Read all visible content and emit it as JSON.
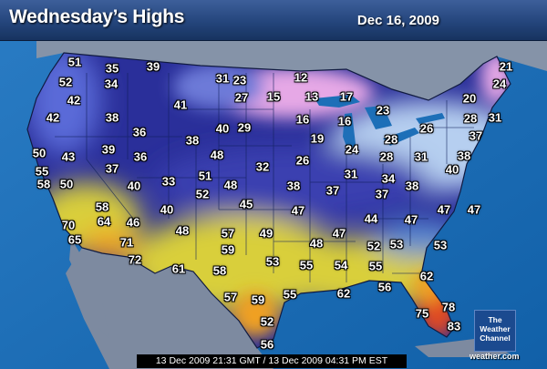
{
  "header": {
    "title": "Wednesday’s Highs",
    "date": "Dec 16, 2009"
  },
  "footer": {
    "timestamp": "13 Dec 2009 21:31 GMT / 13 Dec 2009 04:31 PM EST"
  },
  "logo": {
    "line1": "The",
    "line2": "Weather",
    "line3": "Channel",
    "site": "weather.com"
  },
  "colors": {
    "ocean": "#1d6fb8",
    "neighbor_land": "#7d8aa0",
    "very_cold": "#e6a8e6",
    "cold": "#b6cff0",
    "cool": "#4b56c8",
    "mild": "#2a2f9a",
    "warm": "#d9cf3a",
    "hot": "#f0a020",
    "very_hot": "#e04a20"
  },
  "temperatures": [
    "51",
    "35",
    "39",
    "31",
    "23",
    "12",
    "21",
    "52",
    "34",
    "27",
    "15",
    "13",
    "17",
    "20",
    "24",
    "42",
    "41",
    "23",
    "42",
    "38",
    "36",
    "40",
    "29",
    "16",
    "16",
    "26",
    "28",
    "31",
    "37",
    "38",
    "19",
    "28",
    "50",
    "43",
    "39",
    "36",
    "48",
    "32",
    "26",
    "24",
    "28",
    "31",
    "38",
    "55",
    "37",
    "51",
    "31",
    "34",
    "40",
    "58",
    "50",
    "40",
    "33",
    "52",
    "48",
    "38",
    "37",
    "37",
    "38",
    "45",
    "47",
    "58",
    "44",
    "47",
    "47",
    "47",
    "70",
    "64",
    "46",
    "40",
    "57",
    "49",
    "65",
    "71",
    "48",
    "59",
    "47",
    "48",
    "52",
    "53",
    "53",
    "72",
    "61",
    "58",
    "53",
    "55",
    "54",
    "55",
    "62",
    "56",
    "57",
    "59",
    "55",
    "62",
    "78",
    "75",
    "52",
    "83",
    "56"
  ]
}
